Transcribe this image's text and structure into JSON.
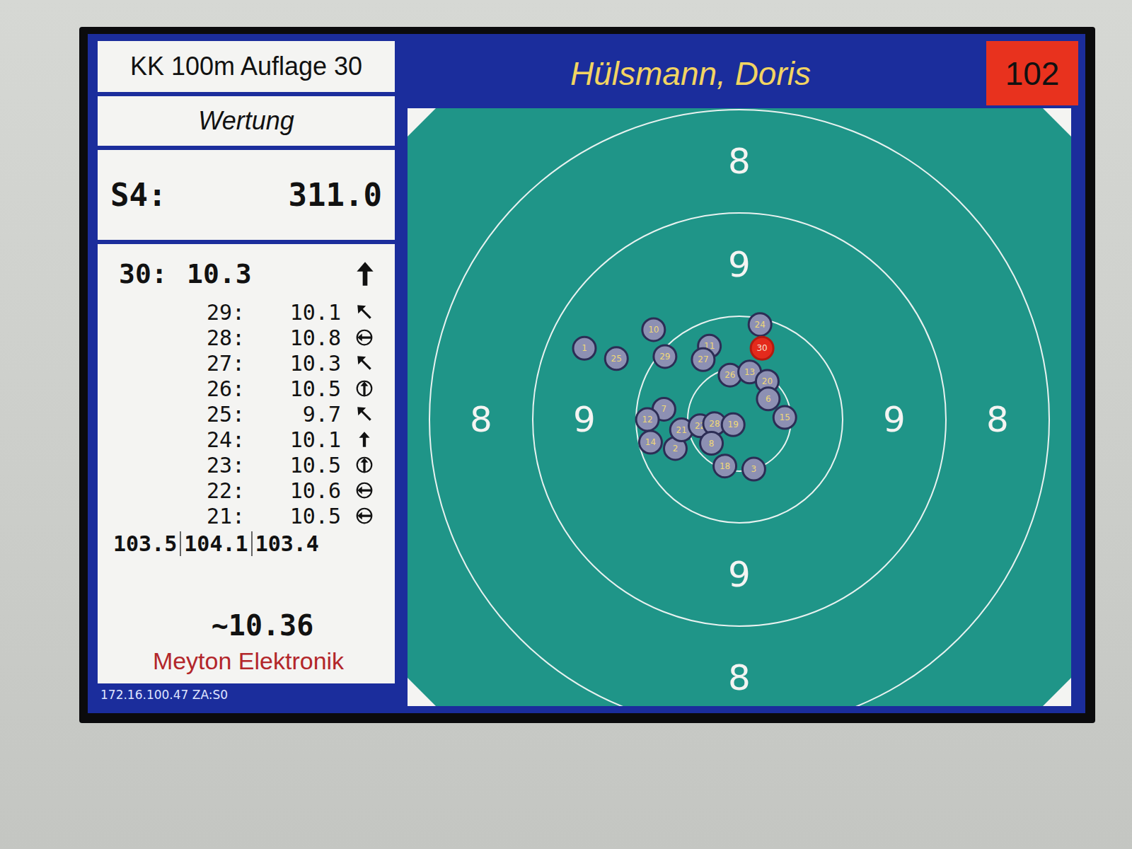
{
  "discipline": "KK 100m Auflage 30",
  "mode": "Wertung",
  "series": {
    "label": "S4:",
    "total": "311.0"
  },
  "shooter": {
    "name": "Hülsmann, Doris",
    "lane": "102"
  },
  "last_shot": {
    "number": "30:",
    "score": "10.3",
    "kind": "north"
  },
  "shots": [
    {
      "number": "29:",
      "score": "10.1",
      "kind": "northwest"
    },
    {
      "number": "28:",
      "score": "10.8",
      "kind": "ring-horizontal"
    },
    {
      "number": "27:",
      "score": "10.3",
      "kind": "northwest"
    },
    {
      "number": "26:",
      "score": "10.5",
      "kind": "ring-vertical"
    },
    {
      "number": "25:",
      "score": "9.7",
      "kind": "northwest"
    },
    {
      "number": "24:",
      "score": "10.1",
      "kind": "north"
    },
    {
      "number": "23:",
      "score": "10.5",
      "kind": "ring-vertical"
    },
    {
      "number": "22:",
      "score": "10.6",
      "kind": "ring-horizontal"
    },
    {
      "number": "21:",
      "score": "10.5",
      "kind": "ring-horizontal"
    }
  ],
  "totals": [
    "103.5",
    "104.1",
    "103.4"
  ],
  "average": "~10.36",
  "brand": "Meyton Elektronik",
  "status": "172.16.100.47 ZA:S0",
  "target": {
    "rings": [
      {
        "label": "8"
      },
      {
        "label": "9"
      }
    ],
    "holes": [
      {
        "number": "1",
        "x": -1.5,
        "y": -0.69,
        "latest": false
      },
      {
        "number": "25",
        "x": -1.19,
        "y": -0.59,
        "latest": false
      },
      {
        "number": "10",
        "x": -0.83,
        "y": -0.87,
        "latest": false
      },
      {
        "number": "29",
        "x": -0.72,
        "y": -0.61,
        "latest": false
      },
      {
        "number": "11",
        "x": -0.29,
        "y": -0.71,
        "latest": false
      },
      {
        "number": "27",
        "x": -0.35,
        "y": -0.58,
        "latest": false
      },
      {
        "number": "24",
        "x": 0.2,
        "y": -0.92,
        "latest": false
      },
      {
        "number": "26",
        "x": -0.09,
        "y": -0.43,
        "latest": false
      },
      {
        "number": "13",
        "x": 0.1,
        "y": -0.46,
        "latest": false
      },
      {
        "number": "20",
        "x": 0.27,
        "y": -0.37,
        "latest": false
      },
      {
        "number": "6",
        "x": 0.28,
        "y": -0.2,
        "latest": false
      },
      {
        "number": "15",
        "x": 0.44,
        "y": -0.02,
        "latest": false
      },
      {
        "number": "7",
        "x": -0.73,
        "y": -0.1,
        "latest": false
      },
      {
        "number": "12",
        "x": -0.89,
        "y": 0.0,
        "latest": false
      },
      {
        "number": "14",
        "x": -0.86,
        "y": 0.22,
        "latest": false
      },
      {
        "number": "2",
        "x": -0.62,
        "y": 0.28,
        "latest": false
      },
      {
        "number": "21",
        "x": -0.56,
        "y": 0.1,
        "latest": false
      },
      {
        "number": "22",
        "x": -0.38,
        "y": 0.06,
        "latest": false
      },
      {
        "number": "28",
        "x": -0.24,
        "y": 0.04,
        "latest": false
      },
      {
        "number": "19",
        "x": -0.06,
        "y": 0.05,
        "latest": false
      },
      {
        "number": "8",
        "x": -0.27,
        "y": 0.23,
        "latest": false
      },
      {
        "number": "18",
        "x": -0.14,
        "y": 0.45,
        "latest": false
      },
      {
        "number": "3",
        "x": 0.14,
        "y": 0.48,
        "latest": false
      },
      {
        "number": "30",
        "x": 0.22,
        "y": -0.69,
        "latest": true
      }
    ]
  }
}
